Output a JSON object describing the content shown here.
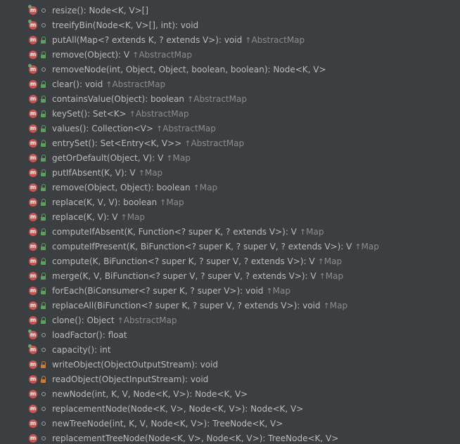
{
  "colors": {
    "background": "#3c3f41",
    "text": "#bbbbbb",
    "muted": "#8c8c8c",
    "method_icon": "#c75450",
    "public_icon": "#5f9f5f"
  },
  "icons": {
    "method": "method-icon",
    "private": "private-dot-icon",
    "public": "public-lock-icon",
    "locked": "private-lock-icon",
    "inherited": "up-arrow-icon"
  },
  "rows": [
    {
      "signature": "resize(): Node<K, V>[]",
      "vis": "private",
      "sub": true,
      "owner": ""
    },
    {
      "signature": "treeifyBin(Node<K, V>[], int): void",
      "vis": "private",
      "sub": true,
      "owner": ""
    },
    {
      "signature": "putAll(Map<? extends K, ? extends V>): void",
      "vis": "public",
      "sub": false,
      "owner": "AbstractMap"
    },
    {
      "signature": "remove(Object): V",
      "vis": "public",
      "sub": false,
      "owner": "AbstractMap"
    },
    {
      "signature": "removeNode(int, Object, Object, boolean, boolean): Node<K, V>",
      "vis": "private",
      "sub": true,
      "owner": ""
    },
    {
      "signature": "clear(): void",
      "vis": "public",
      "sub": false,
      "owner": "AbstractMap"
    },
    {
      "signature": "containsValue(Object): boolean",
      "vis": "public",
      "sub": false,
      "owner": "AbstractMap"
    },
    {
      "signature": "keySet(): Set<K>",
      "vis": "public",
      "sub": false,
      "owner": "AbstractMap"
    },
    {
      "signature": "values(): Collection<V>",
      "vis": "public",
      "sub": false,
      "owner": "AbstractMap"
    },
    {
      "signature": "entrySet(): Set<Entry<K, V>>",
      "vis": "public",
      "sub": false,
      "owner": "AbstractMap"
    },
    {
      "signature": "getOrDefault(Object, V): V",
      "vis": "public",
      "sub": false,
      "owner": "Map"
    },
    {
      "signature": "putIfAbsent(K, V): V",
      "vis": "public",
      "sub": false,
      "owner": "Map"
    },
    {
      "signature": "remove(Object, Object): boolean",
      "vis": "public",
      "sub": false,
      "owner": "Map"
    },
    {
      "signature": "replace(K, V, V): boolean",
      "vis": "public",
      "sub": false,
      "owner": "Map"
    },
    {
      "signature": "replace(K, V): V",
      "vis": "public",
      "sub": false,
      "owner": "Map"
    },
    {
      "signature": "computeIfAbsent(K, Function<? super K, ? extends V>): V",
      "vis": "public",
      "sub": false,
      "owner": "Map"
    },
    {
      "signature": "computeIfPresent(K, BiFunction<? super K, ? super V, ? extends V>): V",
      "vis": "public",
      "sub": false,
      "owner": "Map"
    },
    {
      "signature": "compute(K, BiFunction<? super K, ? super V, ? extends V>): V",
      "vis": "public",
      "sub": false,
      "owner": "Map"
    },
    {
      "signature": "merge(K, V, BiFunction<? super V, ? super V, ? extends V>): V",
      "vis": "public",
      "sub": false,
      "owner": "Map"
    },
    {
      "signature": "forEach(BiConsumer<? super K, ? super V>): void",
      "vis": "public",
      "sub": false,
      "owner": "Map"
    },
    {
      "signature": "replaceAll(BiFunction<? super K, ? super V, ? extends V>): void",
      "vis": "public",
      "sub": false,
      "owner": "Map"
    },
    {
      "signature": "clone(): Object",
      "vis": "public",
      "sub": false,
      "owner": "AbstractMap"
    },
    {
      "signature": "loadFactor(): float",
      "vis": "private",
      "sub": true,
      "owner": ""
    },
    {
      "signature": "capacity(): int",
      "vis": "private",
      "sub": true,
      "owner": ""
    },
    {
      "signature": "writeObject(ObjectOutputStream): void",
      "vis": "locked",
      "sub": false,
      "owner": ""
    },
    {
      "signature": "readObject(ObjectInputStream): void",
      "vis": "locked",
      "sub": false,
      "owner": ""
    },
    {
      "signature": "newNode(int, K, V, Node<K, V>): Node<K, V>",
      "vis": "private",
      "sub": false,
      "owner": ""
    },
    {
      "signature": "replacementNode(Node<K, V>, Node<K, V>): Node<K, V>",
      "vis": "private",
      "sub": false,
      "owner": ""
    },
    {
      "signature": "newTreeNode(int, K, V, Node<K, V>): TreeNode<K, V>",
      "vis": "private",
      "sub": false,
      "owner": ""
    },
    {
      "signature": "replacementTreeNode(Node<K, V>, Node<K, V>): TreeNode<K, V>",
      "vis": "private",
      "sub": false,
      "owner": ""
    }
  ]
}
